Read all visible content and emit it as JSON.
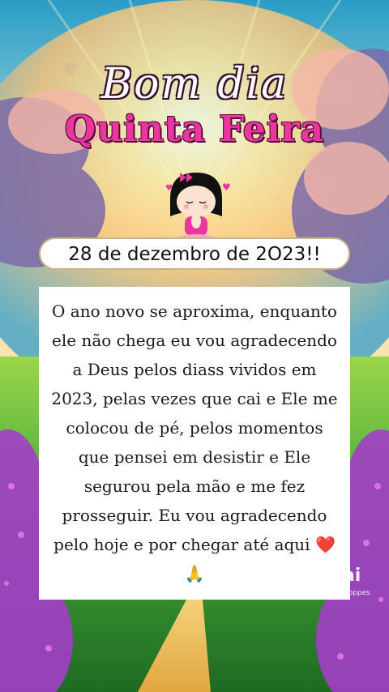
{
  "greeting": {
    "line1": "Bom dia",
    "line2": "Quinta Feira"
  },
  "date": "28 de dezembro de 2O23!!",
  "message": {
    "text": "O ano novo se aproxima, enquanto ele não chega eu vou agradecendo a Deus pelos diass vividos em 2023, pelas vezes que cai e Ele me colocou de pé, pelos momentos que pensei em desistir e Ele segurou pela mão e me fez prosseguir. Eu vou agradecendo pelo hoje e por chegar até aqui",
    "emoji_heart": "❤️",
    "emoji_pray": "🙏"
  },
  "watermark": {
    "brand": "kwai",
    "user": "@Rosanaaloppes"
  },
  "colors": {
    "title_pink": "#e8379e",
    "sky": "#4ab8d8",
    "grass": "#4caf3a",
    "flowers": "#a23ec8"
  }
}
